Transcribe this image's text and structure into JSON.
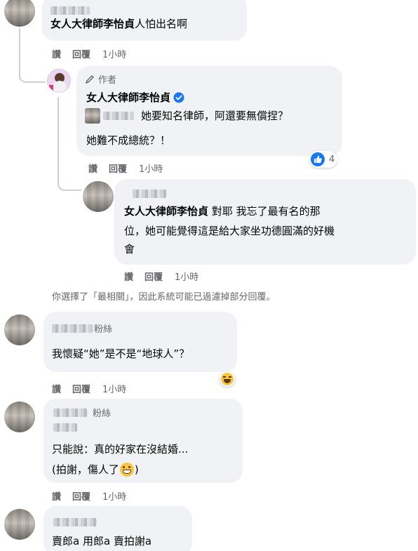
{
  "comments": {
    "c1": {
      "author_tag": "女人大律師李怡貞",
      "text": "人怕出名啊",
      "like": "讚",
      "reply": "回覆",
      "time": "1小時"
    },
    "c2": {
      "badge": "作者",
      "author": "女人大律師李怡貞",
      "text_line1": "她要知名律師，阿還要無償捏？",
      "text_line2": "她難不成總統？！",
      "reaction_count": "4",
      "like": "讚",
      "reply": "回覆",
      "time": "1小時"
    },
    "c3": {
      "author_tag": "女人大律師李怡貞",
      "text_line1": "對耶 我忘了最有名的那",
      "text_line2": "位，她可能覺得這是給大家坐功德圓滿的好機",
      "text_line3": "會",
      "like": "讚",
      "reply": "回覆",
      "time": "1小時"
    },
    "filter_notice": "你選擇了「最相關」，因此系統可能已過濾掉部分回覆。",
    "c4": {
      "fan_suffix": "粉絲",
      "text": "我懷疑“她”是不是“地球人”？",
      "like": "讚",
      "reply": "回覆",
      "time": "1小時"
    },
    "c5": {
      "fan_label": "粉絲",
      "text_line1": "只能說：真的好家在沒結婚...",
      "text_line2": "(拍謝，傷人了",
      "text_line2_end": ")",
      "like": "讚",
      "reply": "回覆",
      "time": "1小時"
    },
    "c6": {
      "text": "賣郎a 用郎a 賣拍謝a"
    }
  },
  "colors": {
    "bubble": "#f0f2f5",
    "meta": "#65676b",
    "verified": "#1877f2",
    "like_blue": "#1877f2",
    "thread_line": "#ccd0d5"
  }
}
